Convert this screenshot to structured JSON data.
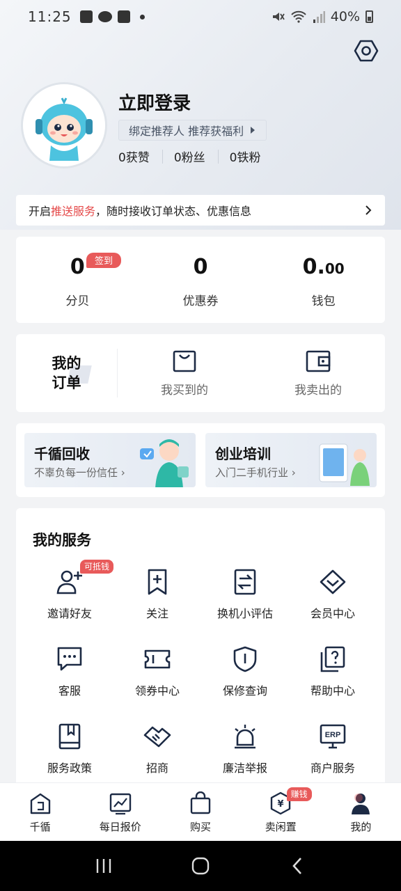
{
  "status_bar": {
    "time": "11:25",
    "battery": "40%"
  },
  "profile": {
    "login_title": "立即登录",
    "referral_text": "绑定推荐人 推荐获福利",
    "stats": [
      "0获赞",
      "0粉丝",
      "0铁粉"
    ]
  },
  "push_banner": {
    "prefix": "开启",
    "highlight": "推送服务",
    "suffix": "，随时接收订单状态、优惠信息"
  },
  "wallet": {
    "checkin_badge": "签到",
    "items": [
      {
        "value": "0",
        "decimal": "",
        "label": "分贝"
      },
      {
        "value": "0",
        "decimal": "",
        "label": "优惠券"
      },
      {
        "value": "0.",
        "decimal": "00",
        "label": "钱包"
      }
    ]
  },
  "orders": {
    "title_line1": "我的",
    "title_line2": "订单",
    "items": [
      {
        "label": "我买到的",
        "icon": "shopping-bag-icon"
      },
      {
        "label": "我卖出的",
        "icon": "wallet-icon"
      }
    ]
  },
  "promos": [
    {
      "title": "千循回收",
      "subtitle": "不辜负每一份信任 ›"
    },
    {
      "title": "创业培训",
      "subtitle": "入门二手机行业 ›"
    }
  ],
  "services": {
    "title": "我的服务",
    "badge": "可抵钱",
    "items": [
      {
        "label": "邀请好友",
        "icon": "add-user-icon"
      },
      {
        "label": "关注",
        "icon": "bookmark-plus-icon"
      },
      {
        "label": "换机小评估",
        "icon": "swap-icon"
      },
      {
        "label": "会员中心",
        "icon": "diamond-icon"
      },
      {
        "label": "客服",
        "icon": "chat-icon"
      },
      {
        "label": "领券中心",
        "icon": "ticket-icon"
      },
      {
        "label": "保修查询",
        "icon": "shield-icon"
      },
      {
        "label": "帮助中心",
        "icon": "help-icon"
      },
      {
        "label": "服务政策",
        "icon": "book-icon"
      },
      {
        "label": "招商",
        "icon": "handshake-icon"
      },
      {
        "label": "廉洁举报",
        "icon": "alarm-icon"
      },
      {
        "label": "商户服务",
        "icon": "erp-icon"
      }
    ]
  },
  "tabs": [
    {
      "label": "千循",
      "icon": "home-icon"
    },
    {
      "label": "每日报价",
      "icon": "chart-icon"
    },
    {
      "label": "购买",
      "icon": "bag-icon"
    },
    {
      "label": "卖闲置",
      "icon": "sell-icon",
      "badge": "赚钱"
    },
    {
      "label": "我的",
      "icon": "profile-icon"
    }
  ],
  "colors": {
    "accent_red": "#e85a5a",
    "primary_dark": "#1c2a44"
  }
}
